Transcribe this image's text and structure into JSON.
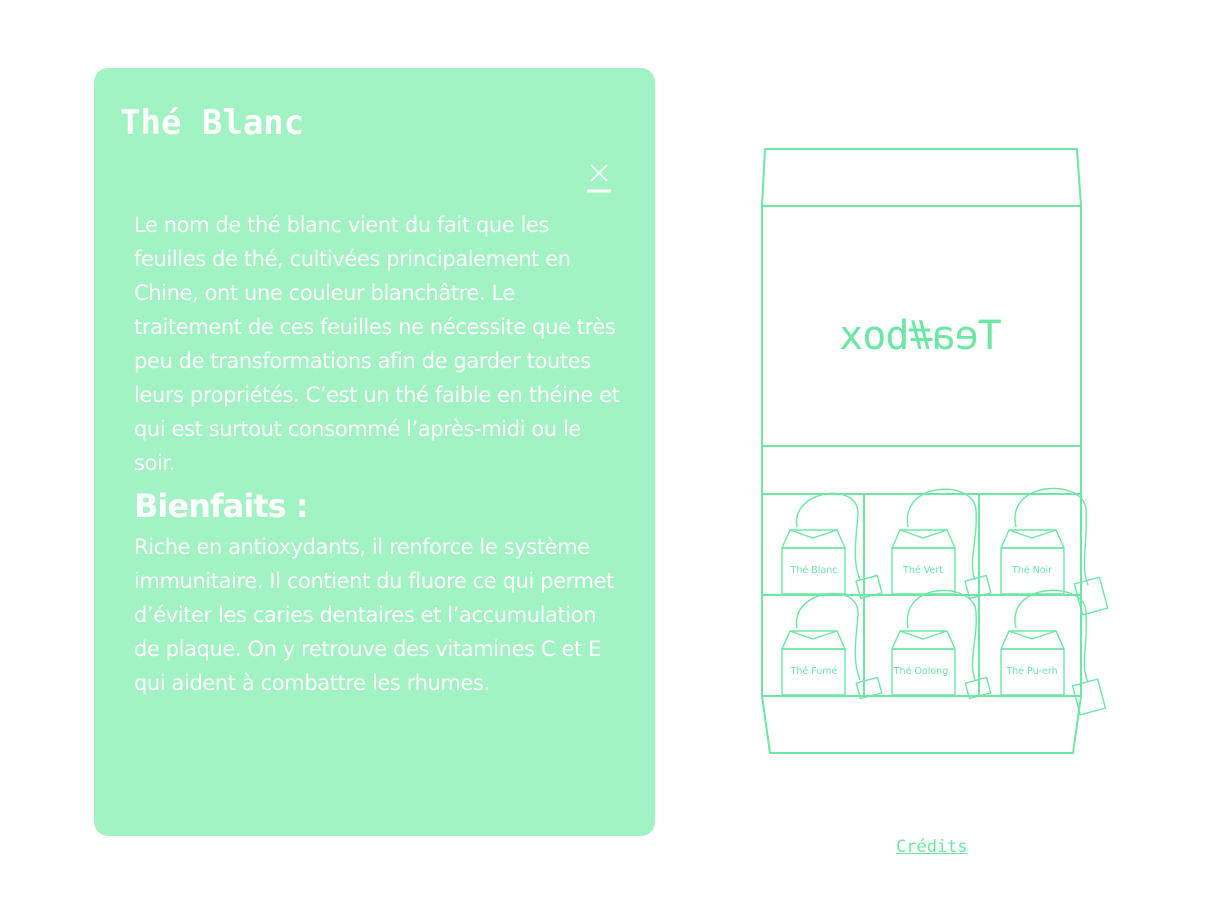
{
  "panel": {
    "title": "Thé Blanc",
    "description": "Le nom de thé blanc vient du fait que les feuilles de thé, cultivées principalement en Chine, ont une couleur blanchâtre. Le traitement de ces feuilles ne nécessite que très peu de transformations afin de garder toutes leurs propriétés. C’est un thé faible en théine et qui est surtout consommé l’après-midi ou le soir.",
    "benefits_heading": "Bienfaits :",
    "benefits_text": "Riche en antioxydants, il renforce le système immunitaire. Il contient du fluore ce qui permet d’éviter les caries dentaires et l’accumulation de plaque. On y retrouve des vitamines C et E qui aident à combattre les rhumes."
  },
  "box": {
    "brand": "Tea#box",
    "teas": [
      "Thé Blanc",
      "Thé Vert",
      "Thé Noir",
      "Thé Fumé",
      "Thé Oolong",
      "Thé Pu-erh"
    ]
  },
  "footer": {
    "credits_label": "Crédits"
  },
  "colors": {
    "panel_bg": "#a1f3c3",
    "accent": "#6ce8a4",
    "text": "#ffffff"
  },
  "icons": {
    "close": "close-icon"
  }
}
